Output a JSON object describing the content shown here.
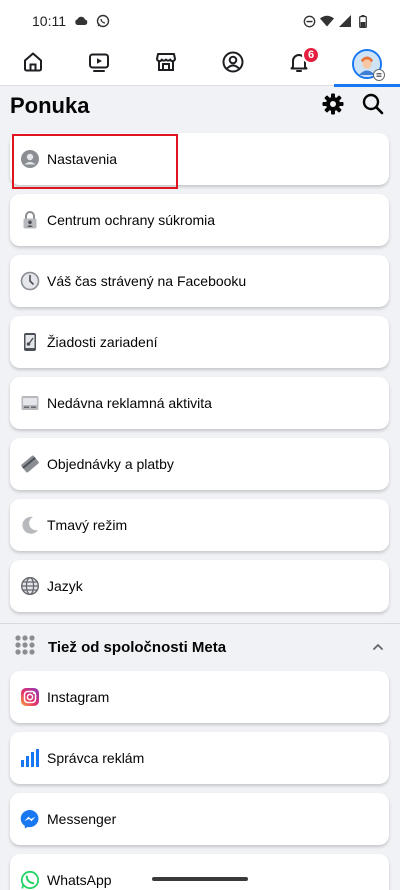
{
  "status_bar": {
    "time": "10:11",
    "left_icons": [
      "cloud-icon",
      "whatsapp-notification-icon"
    ],
    "right_icons": [
      "do-not-disturb-icon",
      "wifi-icon",
      "signal-icon",
      "battery-icon"
    ]
  },
  "nav": {
    "tabs": [
      {
        "name": "home",
        "icon": "home-icon"
      },
      {
        "name": "video",
        "icon": "video-icon"
      },
      {
        "name": "marketplace",
        "icon": "marketplace-icon"
      },
      {
        "name": "profile",
        "icon": "profile-icon"
      },
      {
        "name": "notifications",
        "icon": "bell-icon",
        "badge": "6"
      },
      {
        "name": "menu",
        "icon": "avatar-icon",
        "active": true
      }
    ]
  },
  "header": {
    "title": "Ponuka",
    "icons": [
      "settings-gear-icon",
      "search-icon"
    ]
  },
  "menu_items": [
    {
      "label": "Nastavenia",
      "icon": "user-settings-icon"
    },
    {
      "label": "Centrum ochrany súkromia",
      "icon": "privacy-lock-icon"
    },
    {
      "label": "Váš čas strávený na Facebooku",
      "icon": "clock-icon"
    },
    {
      "label": "Žiadosti zariadení",
      "icon": "device-request-icon"
    },
    {
      "label": "Nedávna reklamná aktivita",
      "icon": "ad-activity-icon"
    },
    {
      "label": "Objednávky a platby",
      "icon": "payment-card-icon"
    },
    {
      "label": "Tmavý režim",
      "icon": "moon-icon"
    },
    {
      "label": "Jazyk",
      "icon": "globe-icon"
    }
  ],
  "meta_section": {
    "title": "Tiež od spoločnosti Meta",
    "icon": "apps-grid-icon",
    "toggle_icon": "chevron-up-icon",
    "items": [
      {
        "label": "Instagram",
        "icon": "instagram-icon"
      },
      {
        "label": "Správca reklám",
        "icon": "ads-manager-icon"
      },
      {
        "label": "Messenger",
        "icon": "messenger-icon"
      },
      {
        "label": "WhatsApp",
        "icon": "whatsapp-icon"
      }
    ]
  },
  "colors": {
    "accent": "#1877f2",
    "badge": "#e41e3f",
    "highlight_border": "#e0141e",
    "background": "#f0f2f5"
  }
}
